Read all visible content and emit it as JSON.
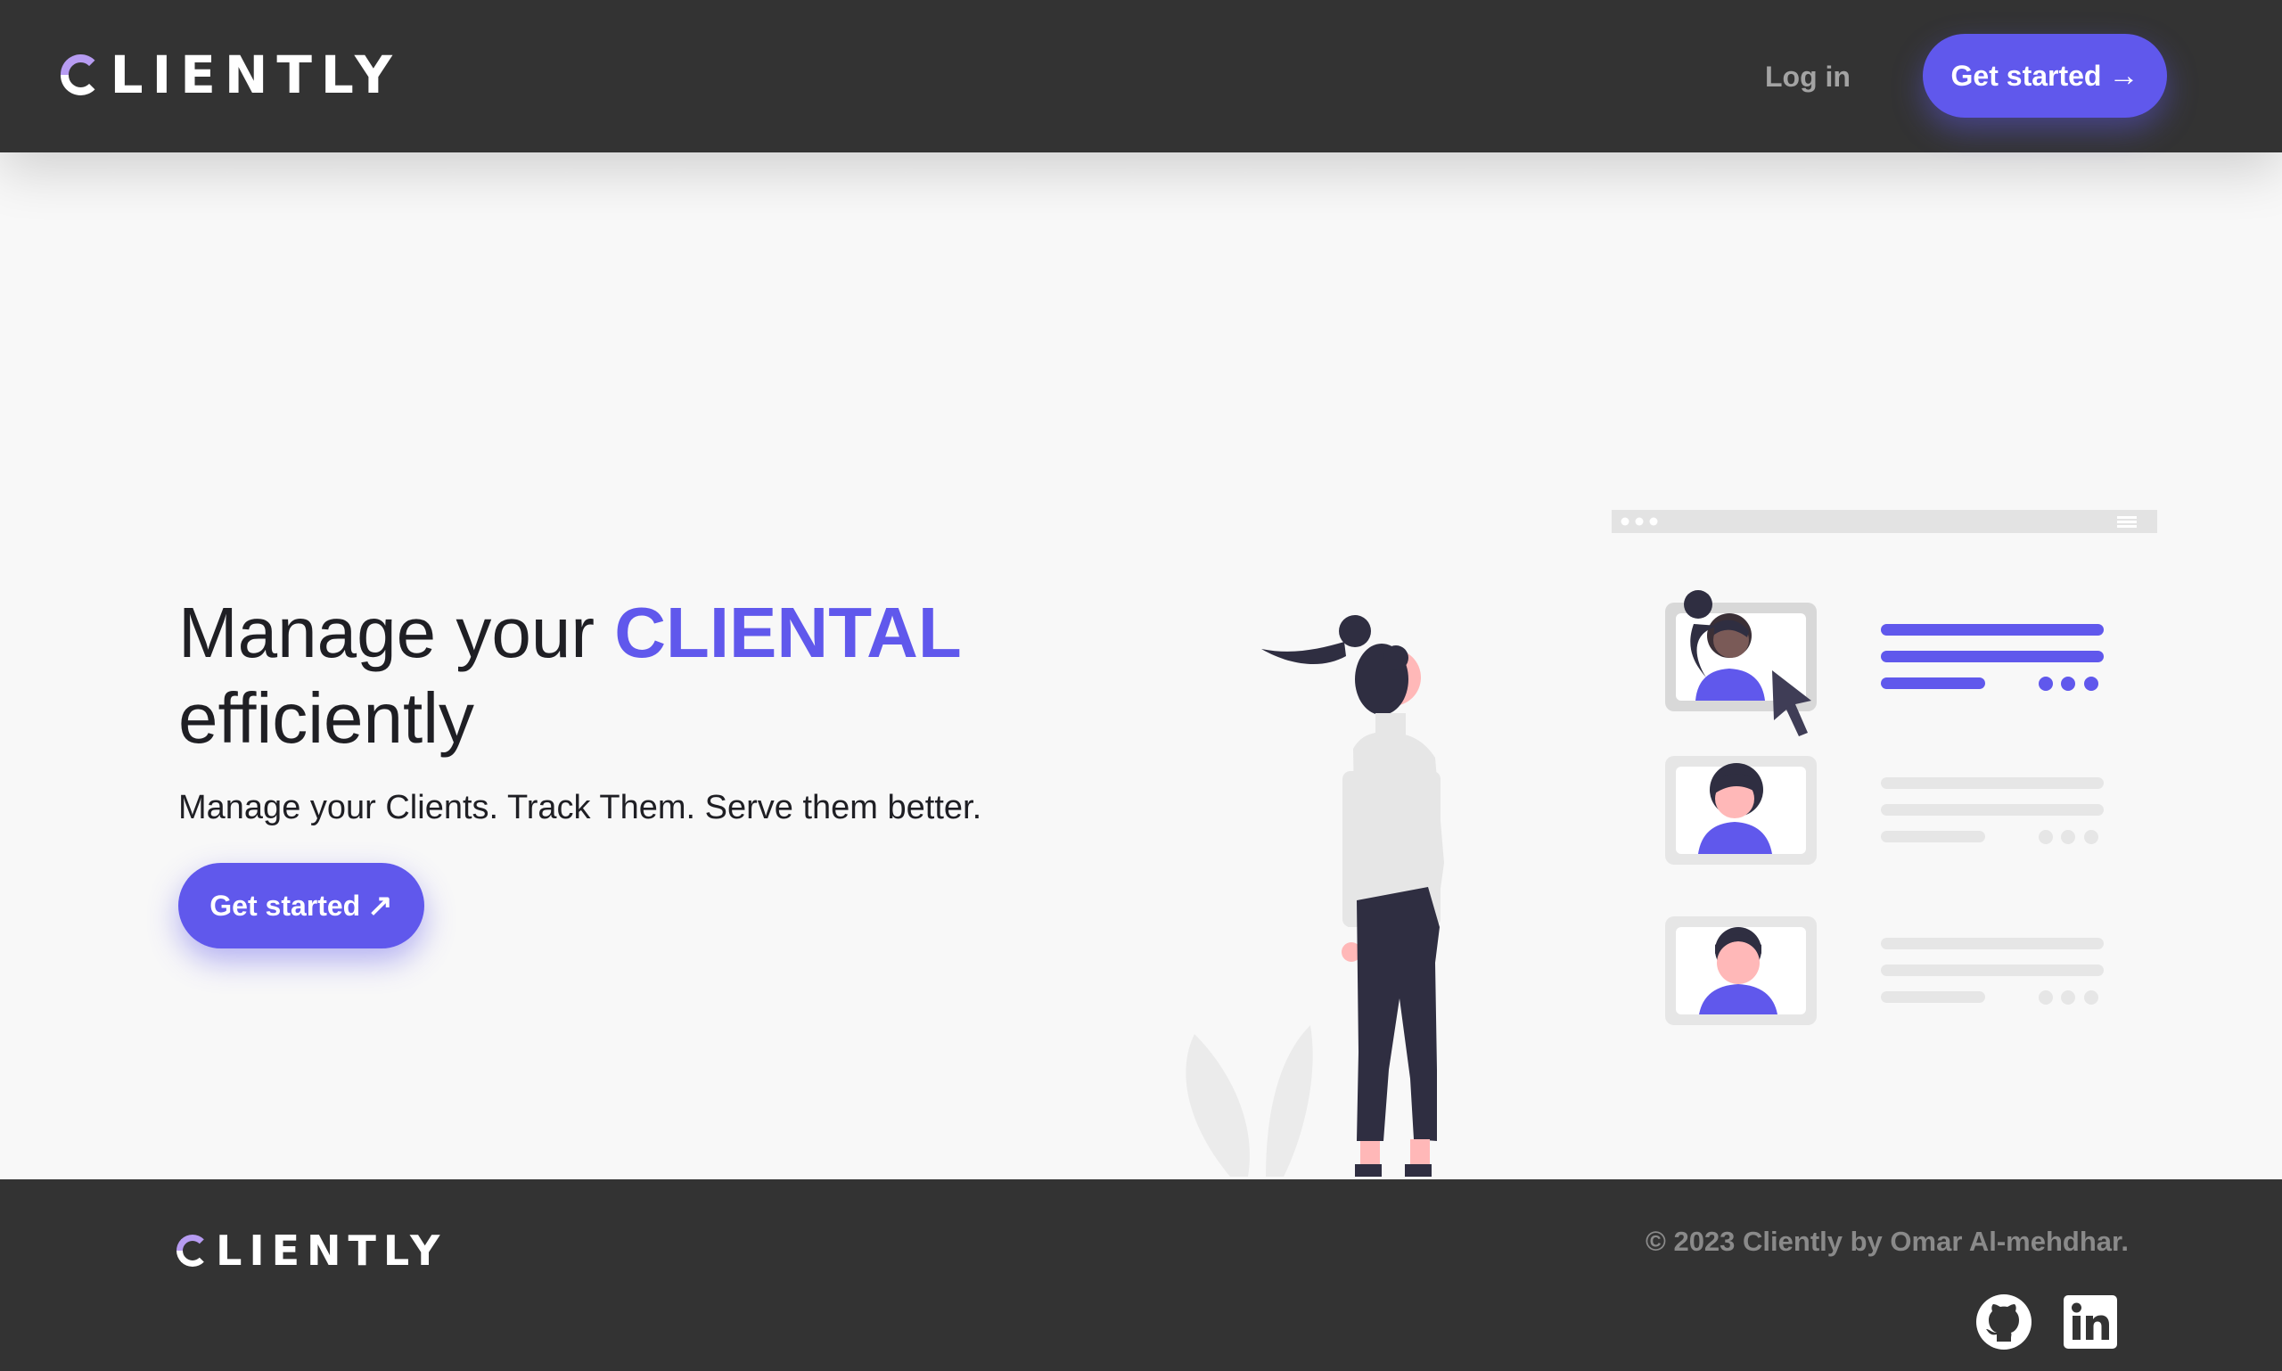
{
  "header": {
    "logo_text": "LIENTLY",
    "login_label": "Log in",
    "cta_label": "Get started",
    "cta_icon": "arrow-right-icon"
  },
  "hero": {
    "title_prefix": "Manage your ",
    "title_accent": "CLIENTAL",
    "title_suffix": "efficiently",
    "subtitle": "Manage your Clients. Track Them. Serve them better.",
    "cta_label": "Get started",
    "cta_icon": "arrow-up-right-icon"
  },
  "footer": {
    "logo_text": "LIENTLY",
    "copyright": "© 2023 Cliently by Omar Al-mehdhar.",
    "social": [
      {
        "name": "github-icon"
      },
      {
        "name": "linkedin-icon"
      }
    ]
  },
  "colors": {
    "header_bg": "#333333",
    "page_bg": "#f8f8f8",
    "accent": "#6058ec",
    "logo_accent": "#b79cf2",
    "muted_text": "#a3a3a3"
  }
}
